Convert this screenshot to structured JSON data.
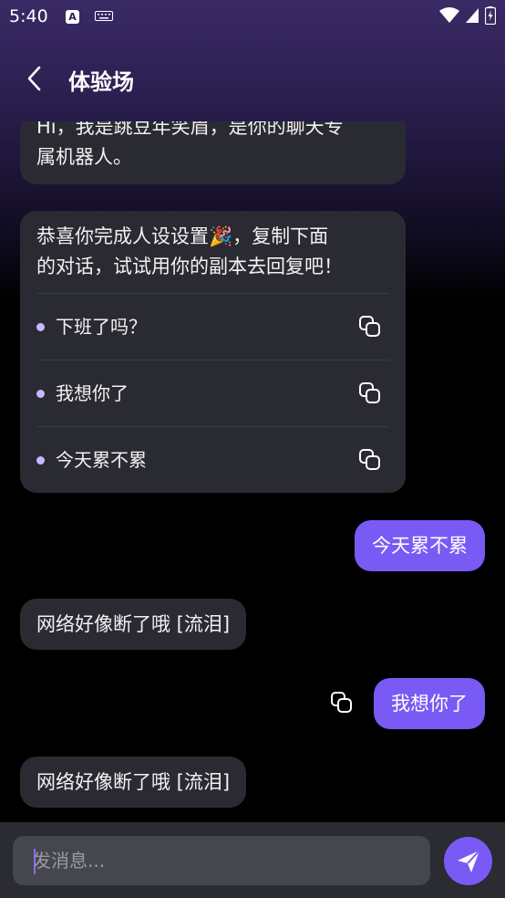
{
  "status_bar": {
    "time": "5:40",
    "a_icon": "A"
  },
  "header": {
    "title": "体验场"
  },
  "messages": {
    "intro_line1": "Hi，我是跳豆年笑眉，是你的聊天专",
    "intro_line2": "属机器人。",
    "congrats_line1": "恭喜你完成人设设置🎉，复制下面",
    "congrats_line2": "的对话，试试用你的副本去回复吧！",
    "suggestions": [
      "下班了吗？",
      "我想你了",
      "今天累不累"
    ],
    "user_msg_1": "今天累不累",
    "bot_reply_1": "网络好像断了哦 [流泪]",
    "user_msg_2": "我想你了",
    "bot_reply_2": "网络好像断了哦 [流泪]"
  },
  "input": {
    "placeholder": "发消息..."
  },
  "colors": {
    "accent": "#7a5af5",
    "bubble": "#2a2a33",
    "input_bar": "#2b2b32"
  }
}
